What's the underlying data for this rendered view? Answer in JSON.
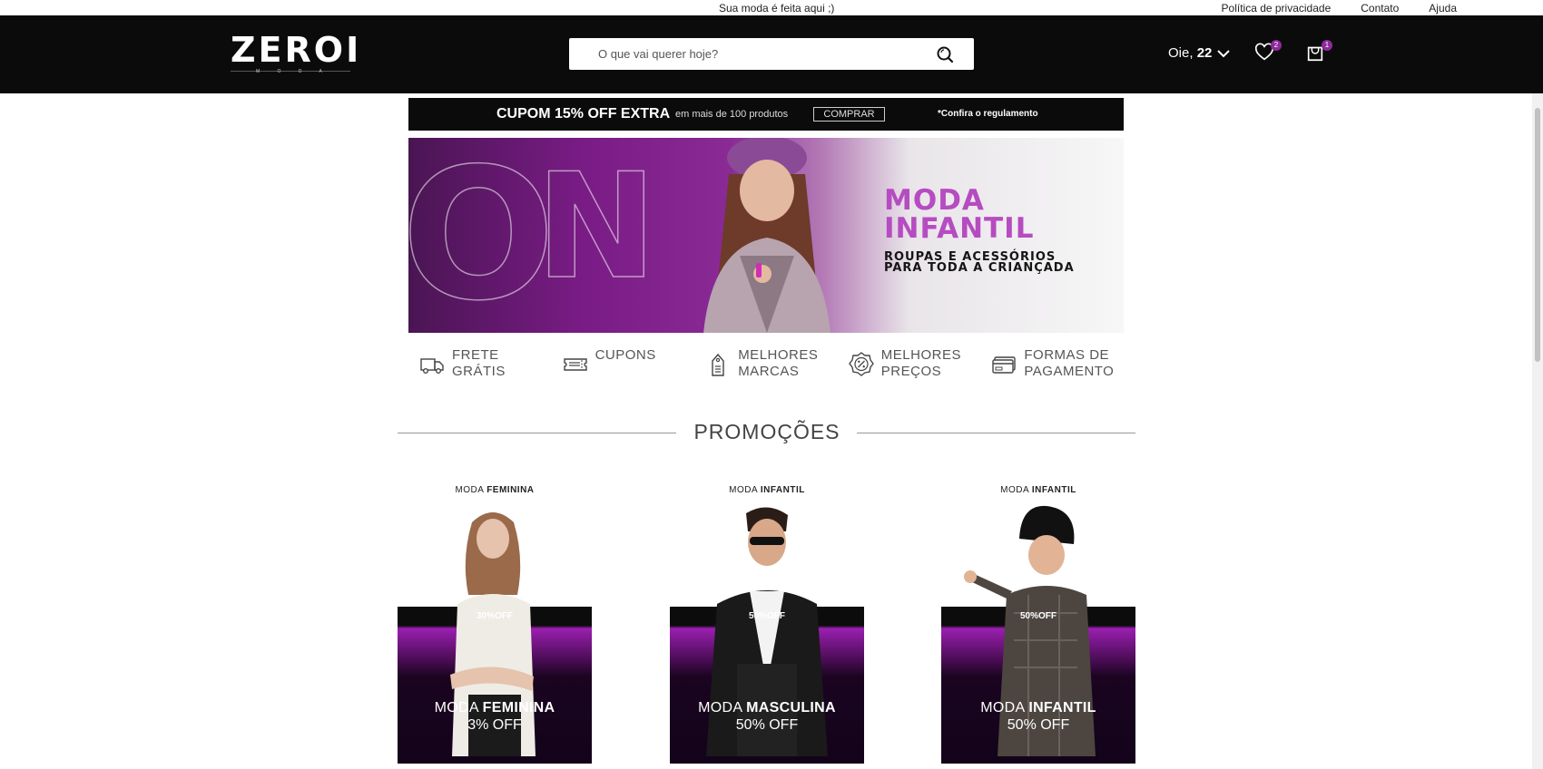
{
  "topbar": {
    "tagline": "Sua moda é feita aqui ;)",
    "links": [
      "Política de privacidade",
      "Contato",
      "Ajuda"
    ]
  },
  "header": {
    "logo": "ZEROI",
    "logo_sub": "M O D A",
    "search_placeholder": "O que vai querer hoje?",
    "greeting_prefix": "Oie, ",
    "greeting_name": "22",
    "wishlist_count": "2",
    "cart_count": "1"
  },
  "coupon": {
    "title": "CUPOM 15% OFF EXTRA",
    "subtitle": "em mais de 100 produtos",
    "button": "COMPRAR",
    "rules": "*Confira o regulamento"
  },
  "hero": {
    "title_line1": "MODA",
    "title_line2": "INFANTIL",
    "subtitle_line1": "ROUPAS E ACESSÓRIOS",
    "subtitle_line2": "PARA TODA A CRIANÇADA"
  },
  "features": [
    {
      "label": "FRETE\nGRÁTIS",
      "icon": "truck-icon"
    },
    {
      "label": "CUPONS",
      "icon": "ticket-icon"
    },
    {
      "label": "MELHORES\nMARCAS",
      "icon": "tag-icon"
    },
    {
      "label": "MELHORES\nPREÇOS",
      "icon": "percent-icon"
    },
    {
      "label": "FORMAS DE\nPAGAMENTO",
      "icon": "card-icon"
    }
  ],
  "promos": {
    "title": "PROMOÇÕES",
    "cards": [
      {
        "cap_light": "MODA ",
        "cap_bold": "FEMININA",
        "off_tag": "30%OFF",
        "title_light": "MODA ",
        "title_bold": "FEMININA",
        "off": "3% OFF"
      },
      {
        "cap_light": "MODA ",
        "cap_bold": "INFANTIL",
        "off_tag": "50%OFF",
        "title_light": "MODA ",
        "title_bold": "MASCULINA",
        "off": "50% OFF"
      },
      {
        "cap_light": "MODA ",
        "cap_bold": "INFANTIL",
        "off_tag": "50%OFF",
        "title_light": "MODA ",
        "title_bold": "INFANTIL",
        "off": "50% OFF"
      }
    ]
  },
  "colors": {
    "header_bg": "#0b0b0b",
    "accent": "#b64cc1",
    "badge": "#8e2a9c"
  }
}
